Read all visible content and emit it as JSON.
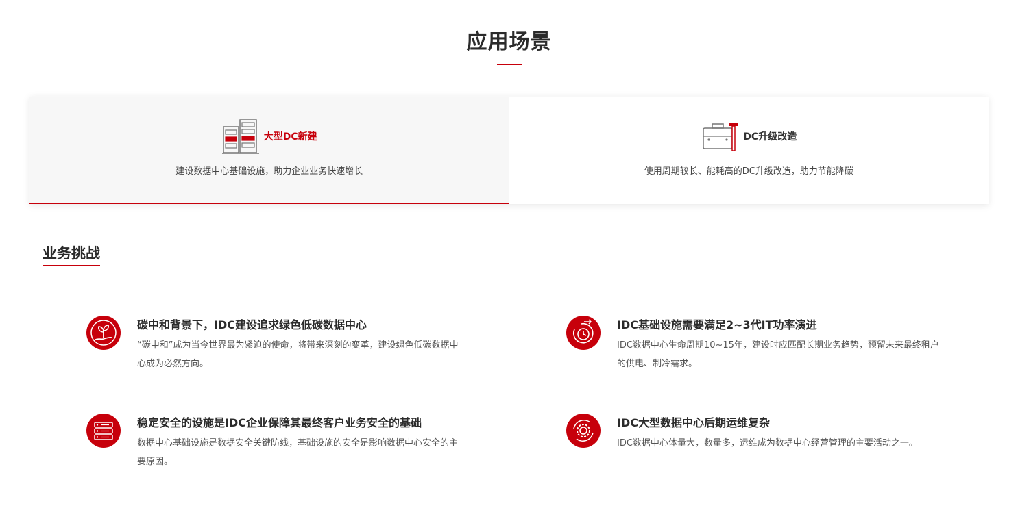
{
  "page": {
    "title": "应用场景",
    "accent_color": "#c7000b"
  },
  "tabs": [
    {
      "label": "大型DC新建",
      "description": "建设数据中心基础设施，助力企业业务快速增长",
      "icon": "server-rack-icon",
      "active": true
    },
    {
      "label": "DC升级改造",
      "description": "使用周期较长、能耗高的DC升级改造，助力节能降碳",
      "icon": "toolbox-hammer-icon",
      "active": false
    }
  ],
  "challenges": {
    "heading": "业务挑战",
    "items": [
      {
        "title": "碳中和背景下，IDC建设追求绿色低碳数据中心",
        "description": "“碳中和”成为当今世界最为紧迫的使命，将带来深刻的变革，建设绿色低碳数据中心成为必然方向。",
        "icon": "plant-hand-icon"
      },
      {
        "title": "IDC基础设施需要满足2~3代IT功率演进",
        "description": "IDC数据中心生命周期10~15年，建设时应匹配长期业务趋势，预留未来最终租户的供电、制冷需求。",
        "icon": "clock-cycle-icon"
      },
      {
        "title": "稳定安全的设施是IDC企业保障其最终客户业务安全的基础",
        "description": "数据中心基础设施是数据安全关键防线，基础设施的安全是影响数据中心安全的主要原因。",
        "icon": "server-stack-icon"
      },
      {
        "title": "IDC大型数据中心后期运维复杂",
        "description": "IDC数据中心体量大，数量多，运维成为数据中心经营管理的主要活动之一。",
        "icon": "gear-cycle-icon"
      }
    ]
  }
}
